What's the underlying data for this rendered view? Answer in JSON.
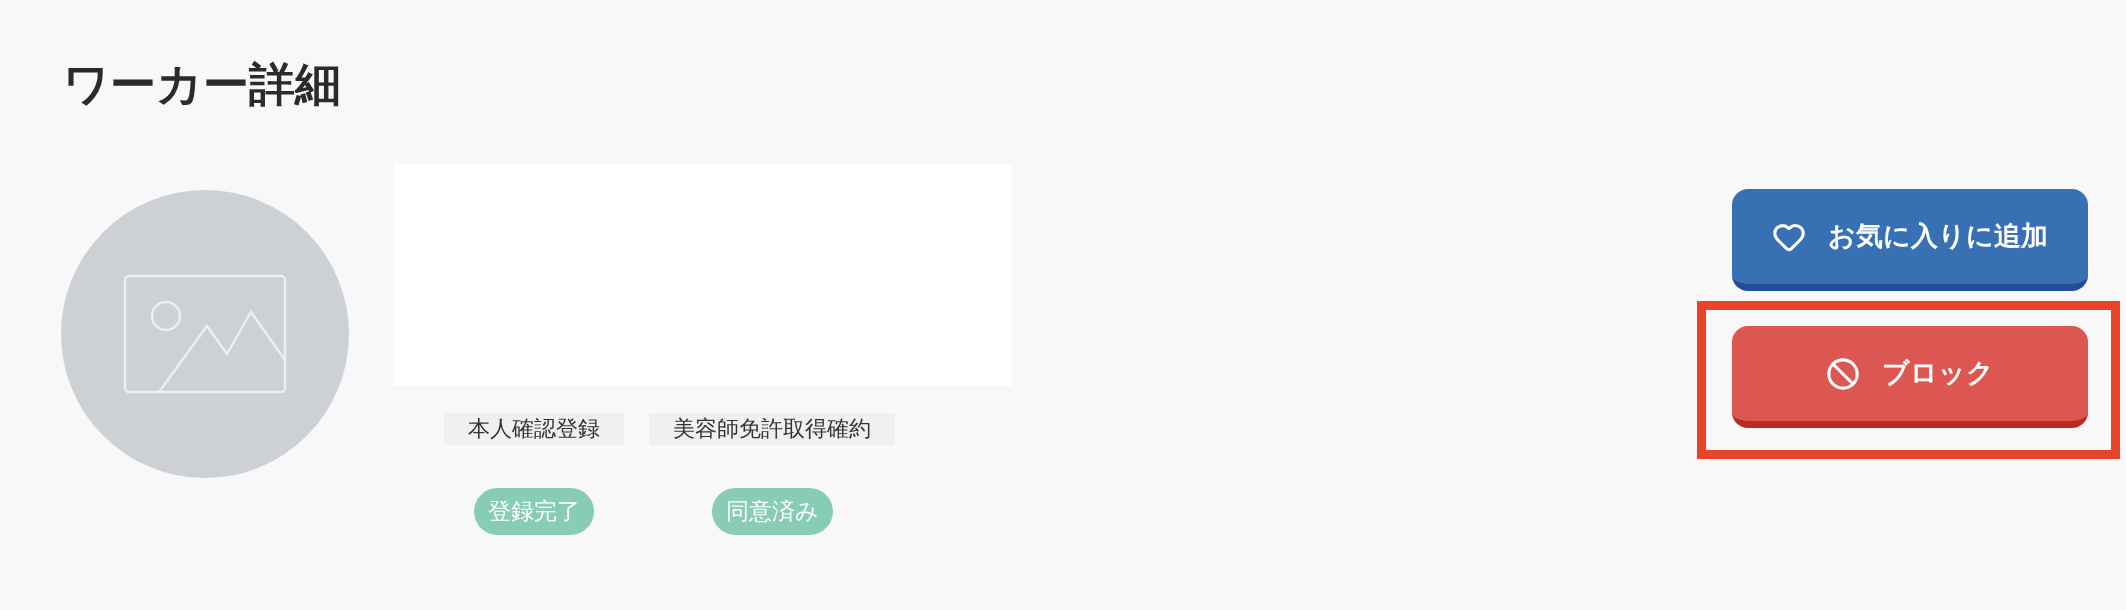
{
  "page": {
    "title": "ワーカー詳細"
  },
  "verifications": [
    {
      "label": "本人確認登録",
      "status": "登録完了"
    },
    {
      "label": "美容師免許取得確約",
      "status": "同意済み"
    }
  ],
  "actions": [
    {
      "kind": "favorite",
      "label": "お気に入りに追加",
      "highlighted": false
    },
    {
      "kind": "block",
      "label": "ブロック",
      "highlighted": true
    }
  ]
}
